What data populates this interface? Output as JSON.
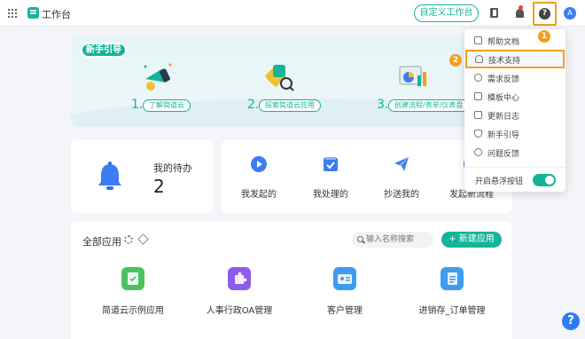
{
  "header": {
    "app_title": "工作台",
    "custom_button": "自定义工作台",
    "help_glyph": "?",
    "avatar_letter": "A"
  },
  "guide": {
    "badge": "新手引导",
    "steps": [
      {
        "num": "1.",
        "label": "了解简道云"
      },
      {
        "num": "2.",
        "label": "探索简道云应用"
      },
      {
        "num": "3.",
        "label": "创建流程/表单/仪表盘"
      }
    ]
  },
  "todo": {
    "label": "我的待办",
    "value": "2"
  },
  "actions": [
    {
      "label": "我发起的"
    },
    {
      "label": "我处理的"
    },
    {
      "label": "抄送我的"
    },
    {
      "label": "发起新流程"
    }
  ],
  "apps": {
    "title": "全部应用",
    "search_placeholder": "输入名称搜索",
    "new_button": "+ 新建应用",
    "items": [
      {
        "name": "简道云示例应用",
        "color": "#4cc163"
      },
      {
        "name": "人事行政OA管理",
        "color": "#8e5be8"
      },
      {
        "name": "客户管理",
        "color": "#3d9cf0"
      },
      {
        "name": "进销存_订单管理",
        "color": "#3d9cf0"
      }
    ]
  },
  "help_menu": {
    "items": [
      {
        "label": "帮助文档",
        "icon": "book-icon"
      },
      {
        "label": "技术支持",
        "icon": "headset-icon"
      },
      {
        "label": "需求反馈",
        "icon": "chat-icon"
      },
      {
        "label": "模板中心",
        "icon": "grid-icon"
      },
      {
        "label": "更新日志",
        "icon": "doc-icon"
      },
      {
        "label": "新手引导",
        "icon": "trophy-icon"
      },
      {
        "label": "问题反馈",
        "icon": "smile-icon"
      }
    ],
    "float_toggle_label": "开启悬浮按钮",
    "float_toggle_on": true
  },
  "annotations": {
    "marker1": "1",
    "marker2": "2"
  },
  "fab_glyph": "?",
  "colors": {
    "accent": "#14b49a",
    "highlight": "#f0a020",
    "blue": "#2f7bf5"
  }
}
